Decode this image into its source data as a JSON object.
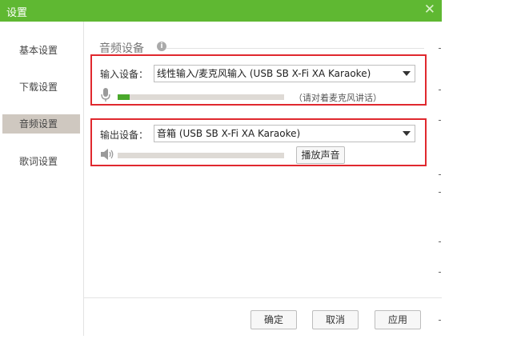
{
  "window": {
    "title": "设置"
  },
  "sidebar": {
    "items": [
      {
        "label": "基本设置"
      },
      {
        "label": "下载设置"
      },
      {
        "label": "音频设置"
      },
      {
        "label": "歌词设置"
      }
    ],
    "active_index": 2
  },
  "audio": {
    "section_title": "音频设备",
    "input": {
      "label": "输入设备：",
      "selected": "线性输入/麦克风输入 (USB SB X-Fi XA Karaoke)",
      "level": 0.07,
      "hint": "（请对着麦克风讲话）"
    },
    "output": {
      "label": "输出设备：",
      "selected": "音箱 (USB SB X-Fi XA Karaoke)",
      "level": 0.0,
      "play_button": "播放声音"
    }
  },
  "footer": {
    "ok": "确定",
    "cancel": "取消",
    "apply": "应用"
  },
  "colors": {
    "titlebar": "#5fb832",
    "accent": "#4aa82b",
    "highlight_box": "#e0282e"
  }
}
